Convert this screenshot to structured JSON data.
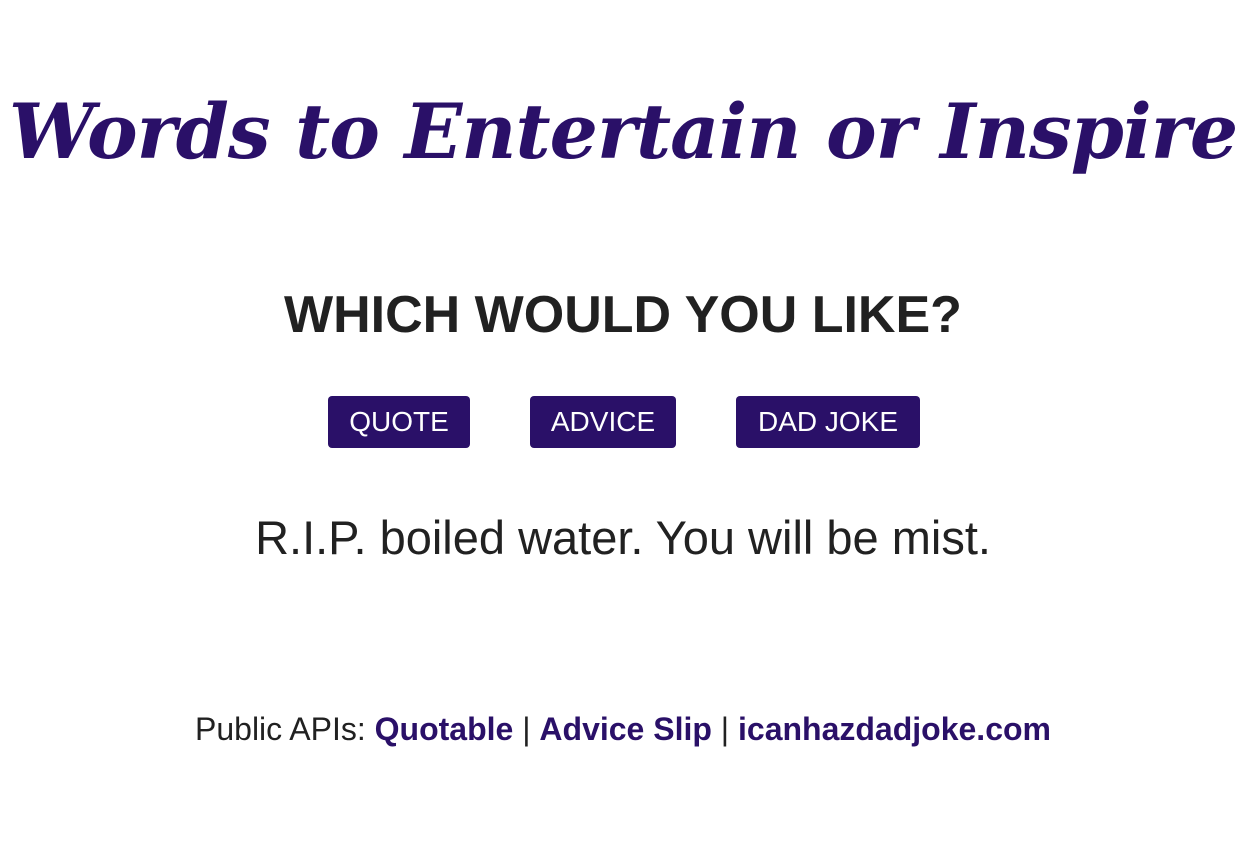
{
  "header": {
    "title": "Words to Entertain or Inspire"
  },
  "main": {
    "question": "WHICH WOULD YOU LIKE?",
    "buttons": {
      "quote": "QUOTE",
      "advice": "ADVICE",
      "dad_joke": "DAD JOKE"
    },
    "result": "R.I.P. boiled water. You will be mist."
  },
  "footer": {
    "prefix": "Public APIs:",
    "separator": "|",
    "links": {
      "quotable": "Quotable",
      "advice_slip": "Advice Slip",
      "icanhazdadjoke": "icanhazdadjoke.com"
    }
  },
  "colors": {
    "accent": "#2a1068",
    "text": "#212121",
    "background": "#ffffff",
    "button_text": "#ffffff"
  }
}
